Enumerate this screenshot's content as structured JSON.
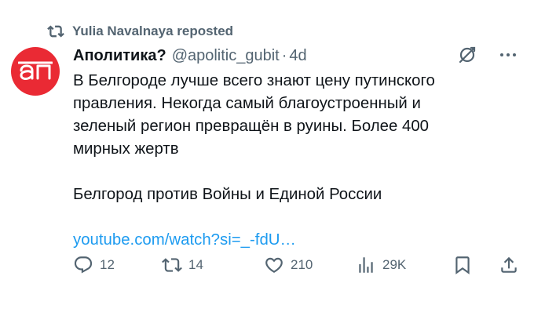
{
  "repost": {
    "icon": "repost-icon",
    "text": "Yulia Navalnaya reposted"
  },
  "tweet": {
    "avatar": {
      "icon": "apolitika-logo",
      "color": "#ea2a34"
    },
    "display_name": "Аполитика?",
    "handle": "@apolitic_gubit",
    "separator": "·",
    "time": "4d",
    "text_lines": [
      "В Белгороде лучше всего знают цену путинского",
      "правления. Некогда самый благоустроенный и",
      "зеленый регион превращён в руины. Более 400",
      "мирных жертв"
    ],
    "text_line_2": "Белгород против Войны и Единой России",
    "link": "youtube.com/watch?si=_-fdU…",
    "link_color": "#1d9bf0"
  },
  "actions": {
    "reply_count": "12",
    "repost_count": "14",
    "like_count": "210",
    "views_count": "29K",
    "icons": [
      "reply-icon",
      "repost-icon",
      "like-icon",
      "views-icon",
      "bookmark-icon",
      "share-icon"
    ]
  },
  "colors": {
    "text": "#0f1419",
    "secondary": "#536471"
  }
}
